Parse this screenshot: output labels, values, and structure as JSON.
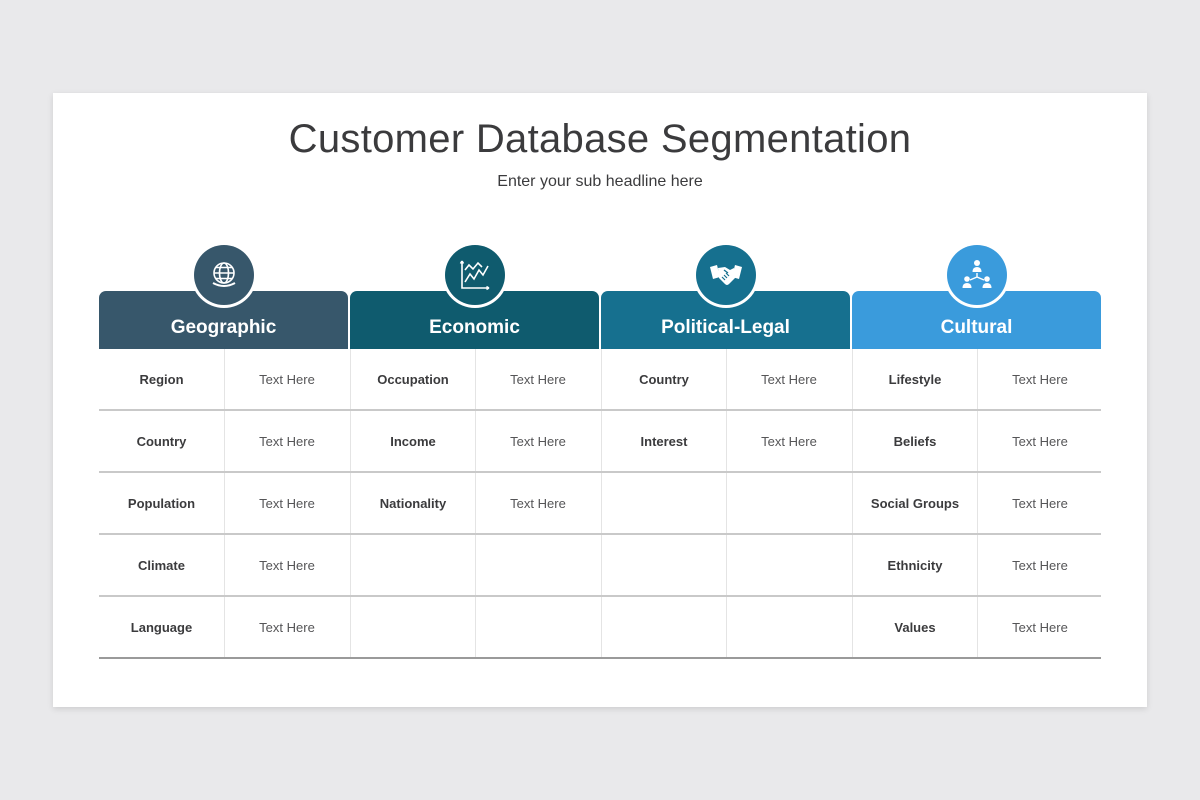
{
  "title": "Customer Database Segmentation",
  "subtitle": "Enter your sub headline here",
  "columns": [
    {
      "label": "Geographic",
      "icon": "globe-icon",
      "color": "#37576b",
      "rows": [
        {
          "key": "Region",
          "value": "Text Here"
        },
        {
          "key": "Country",
          "value": "Text Here"
        },
        {
          "key": "Population",
          "value": "Text Here"
        },
        {
          "key": "Climate",
          "value": "Text Here"
        },
        {
          "key": "Language",
          "value": "Text Here"
        }
      ]
    },
    {
      "label": "Economic",
      "icon": "line-chart-icon",
      "color": "#0f5b6e",
      "rows": [
        {
          "key": "Occupation",
          "value": "Text Here"
        },
        {
          "key": "Income",
          "value": "Text Here"
        },
        {
          "key": "Nationality",
          "value": "Text Here"
        },
        {
          "key": "",
          "value": ""
        },
        {
          "key": "",
          "value": ""
        }
      ]
    },
    {
      "label": "Political-Legal",
      "icon": "handshake-icon",
      "color": "#16708f",
      "rows": [
        {
          "key": "Country",
          "value": "Text Here"
        },
        {
          "key": "Interest",
          "value": "Text Here"
        },
        {
          "key": "",
          "value": ""
        },
        {
          "key": "",
          "value": ""
        },
        {
          "key": "",
          "value": ""
        }
      ]
    },
    {
      "label": "Cultural",
      "icon": "people-network-icon",
      "color": "#3a9bdc",
      "rows": [
        {
          "key": "Lifestyle",
          "value": "Text Here"
        },
        {
          "key": "Beliefs",
          "value": "Text Here"
        },
        {
          "key": "Social Groups",
          "value": "Text Here"
        },
        {
          "key": "Ethnicity",
          "value": "Text Here"
        },
        {
          "key": "Values",
          "value": "Text Here"
        }
      ]
    }
  ]
}
